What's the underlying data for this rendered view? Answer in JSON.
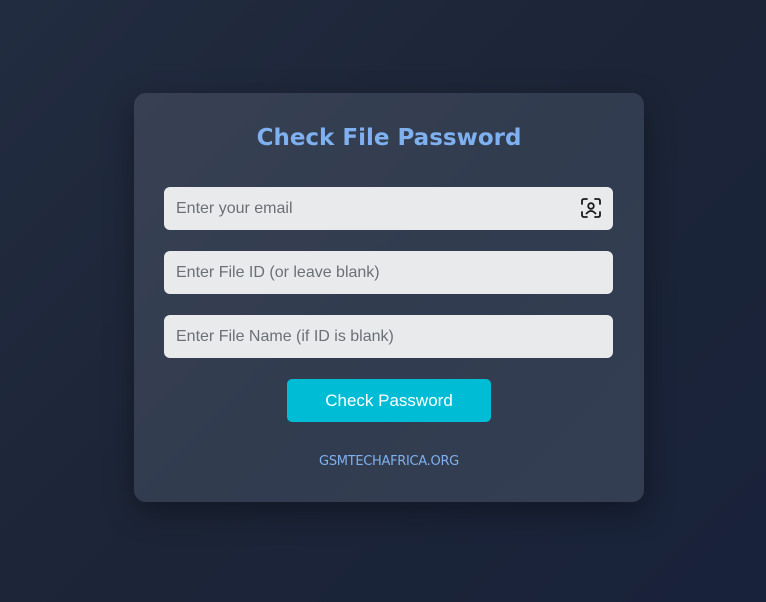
{
  "form": {
    "title": "Check File Password",
    "email_placeholder": "Enter your email",
    "email_value": "",
    "email_icon": "face-scan-icon",
    "file_id_placeholder": "Enter File ID (or leave blank)",
    "file_id_value": "",
    "file_name_placeholder": "Enter File Name (if ID is blank)",
    "file_name_value": "",
    "submit_label": "Check Password",
    "footer_link": "GSMTECHAFRICA.ORG"
  },
  "colors": {
    "background": "#1e2639",
    "card": "#343e51",
    "title": "#7fb0f0",
    "input_bg": "#e9eaec",
    "button": "#00bcd4",
    "link": "#7fb0f0"
  }
}
